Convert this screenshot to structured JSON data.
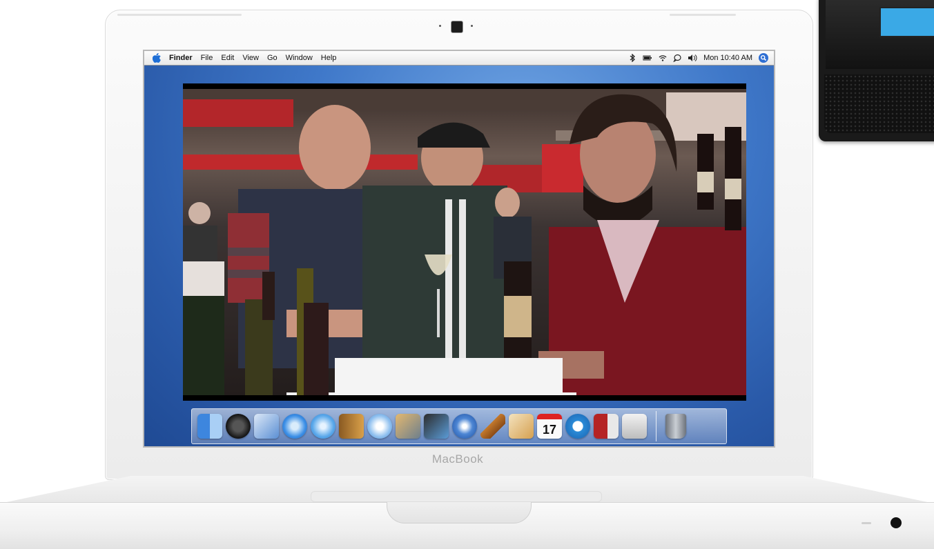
{
  "menubar": {
    "app_name": "Finder",
    "menus": [
      "File",
      "Edit",
      "View",
      "Go",
      "Window",
      "Help"
    ],
    "clock": "Mon 10:40 AM",
    "status_icons": [
      "bluetooth-icon",
      "battery-icon",
      "wifi-icon",
      "ichat-icon",
      "volume-icon",
      "spotlight-icon"
    ]
  },
  "laptop": {
    "brand": "MacBook"
  },
  "dock": {
    "items": [
      {
        "name": "finder",
        "color": "#4a8fe0"
      },
      {
        "name": "dashboard",
        "color": "#2b2b2b"
      },
      {
        "name": "mail",
        "color": "#7aa7e0"
      },
      {
        "name": "safari",
        "color": "#3c8fe6"
      },
      {
        "name": "ichat",
        "color": "#5aa8ea"
      },
      {
        "name": "address-book",
        "color": "#c8913c"
      },
      {
        "name": "itunes",
        "color": "#8fc0ef"
      },
      {
        "name": "iphoto",
        "color": "#6e7f8c"
      },
      {
        "name": "imovie",
        "color": "#2c2c2c"
      },
      {
        "name": "idvd",
        "color": "#4d86d4"
      },
      {
        "name": "garageband",
        "color": "#c47a2c"
      },
      {
        "name": "iweb",
        "color": "#d5a050"
      },
      {
        "name": "ical",
        "color": "#f3f3f3",
        "label": "17"
      },
      {
        "name": "quicktime",
        "color": "#2a8ad6"
      },
      {
        "name": "photo-booth",
        "color": "#b52424"
      },
      {
        "name": "system-preferences",
        "color": "#c9c9c9"
      }
    ],
    "trash": {
      "name": "trash",
      "color": "#9aa0a8"
    }
  }
}
